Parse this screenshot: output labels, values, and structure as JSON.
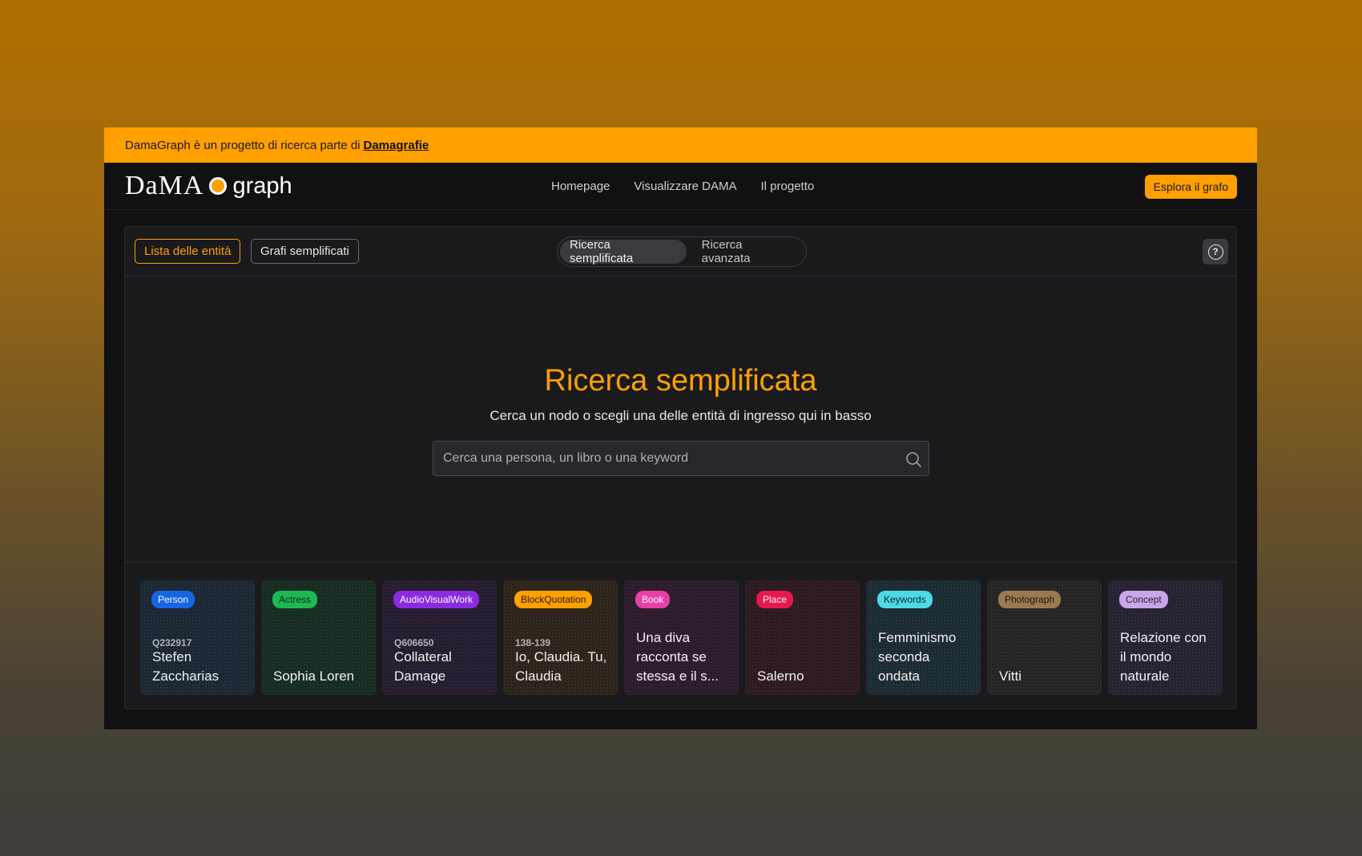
{
  "banner": {
    "text": "DamaGraph è un progetto di ricerca parte di",
    "link": "Damagrafie",
    "color": "#ffa000"
  },
  "header": {
    "logo_dama": "DaMA",
    "logo_graph": "graph",
    "nav": [
      "Homepage",
      "Visualizzare DAMA",
      "Il progetto"
    ],
    "cta": "Esplora il grafo"
  },
  "toolbar": {
    "entities_button": "Lista delle entità",
    "graphs_button": "Grafi semplificati",
    "toggle_active": "Ricerca semplificata",
    "toggle_inactive": "Ricerca avanzata",
    "help_icon": "question-circle-icon",
    "help_glyph": "?"
  },
  "hero": {
    "title": "Ricerca semplificata",
    "subtitle": "Cerca un nodo o scegli una delle entità di ingresso qui in basso",
    "search_placeholder": "Cerca una persona, un libro o una keyword",
    "search_icon": "search-icon"
  },
  "cards": [
    {
      "type": "Person",
      "id": "Q232917",
      "title": "Stefen Zaccharias",
      "badge_color": "#1565e6",
      "bg": "#1b2733"
    },
    {
      "type": "Actress",
      "id": "",
      "title": "Sophia Loren",
      "badge_color": "#1db954",
      "bg": "#162c22",
      "badge_text_color": "#0b2a14"
    },
    {
      "type": "AudioVisualWork",
      "id": "Q606650",
      "title": "Collateral Damage",
      "badge_color": "#8a2be2",
      "bg": "#261c30"
    },
    {
      "type": "BlockQuotation",
      "id": "138-139",
      "title": "Io, Claudia. Tu, Claudia",
      "badge_color": "#ffa000",
      "bg": "#2c241a",
      "badge_text_color": "#2a1a00"
    },
    {
      "type": "Book",
      "id": "",
      "title": "Una diva racconta se stessa e il s...",
      "badge_color": "#e83fa8",
      "bg": "#2c1b2a"
    },
    {
      "type": "Place",
      "id": "",
      "title": "Salerno",
      "badge_color": "#e8184f",
      "bg": "#2d1a20"
    },
    {
      "type": "Keywords",
      "id": "",
      "title": "Femminismo seconda ondata",
      "badge_color": "#4dd9e6",
      "bg": "#1c2a33",
      "badge_text_color": "#0e2a2e"
    },
    {
      "type": "Photograph",
      "id": "",
      "title": "Vitti",
      "badge_color": "#9b7a52",
      "bg": "#242424",
      "badge_text_color": "#1e1408"
    },
    {
      "type": "Concept",
      "id": "",
      "title": "Relazione con il mondo naturale",
      "badge_color": "#c9a6e8",
      "bg": "#262232",
      "badge_text_color": "#2a1a3a"
    }
  ]
}
